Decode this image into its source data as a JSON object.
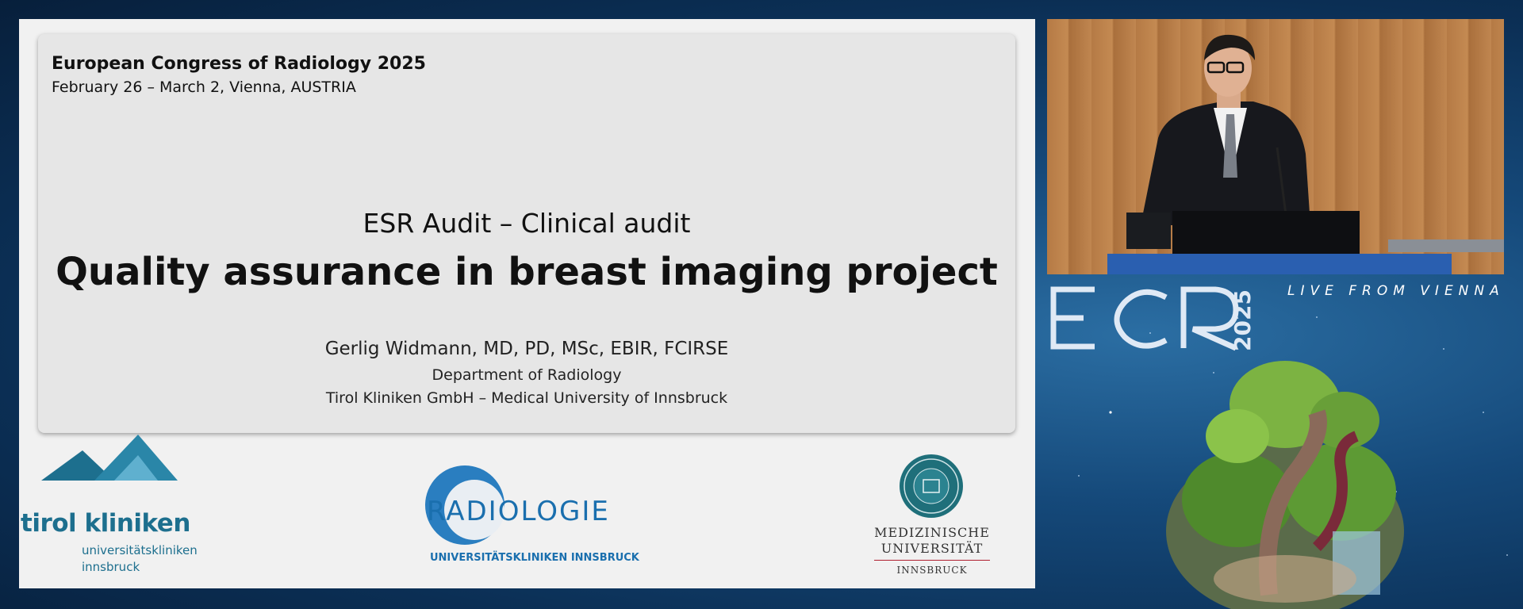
{
  "slide": {
    "conference_name": "European Congress of Radiology 2025",
    "conference_date": "February 26 – March 2, Vienna, AUSTRIA",
    "subtitle": "ESR Audit – Clinical audit",
    "title": "Quality assurance in breast imaging project",
    "author": "Gerlig Widmann, MD, PD, MSc, EBIR, FCIRSE",
    "department": "Department of Radiology",
    "institution": "Tirol Kliniken GmbH – Medical University of Innsbruck"
  },
  "logos": {
    "tirol_kliniken": {
      "name": "tirol kliniken",
      "sub1": "universitätskliniken",
      "sub2": "innsbruck"
    },
    "radiologie": {
      "word": "RADIOLOGIE",
      "sub": "UNIVERSITÄTSKLINIKEN INNSBRUCK"
    },
    "med_uni": {
      "line1": "MEDIZINISCHE",
      "line2": "UNIVERSITÄT",
      "line3": "INNSBRUCK"
    }
  },
  "branding": {
    "ecr_logo": "ECR 2025",
    "tagline": "LIVE FROM VIENNA"
  },
  "colors": {
    "tirol_teal": "#1d6f8e",
    "radiologie_blue": "#1a6fae",
    "med_uni_red": "#b01e2f"
  },
  "icons": [
    "mountain-logo-icon",
    "radiologie-circle-icon",
    "university-seal-icon",
    "earth-tree-illustration"
  ]
}
